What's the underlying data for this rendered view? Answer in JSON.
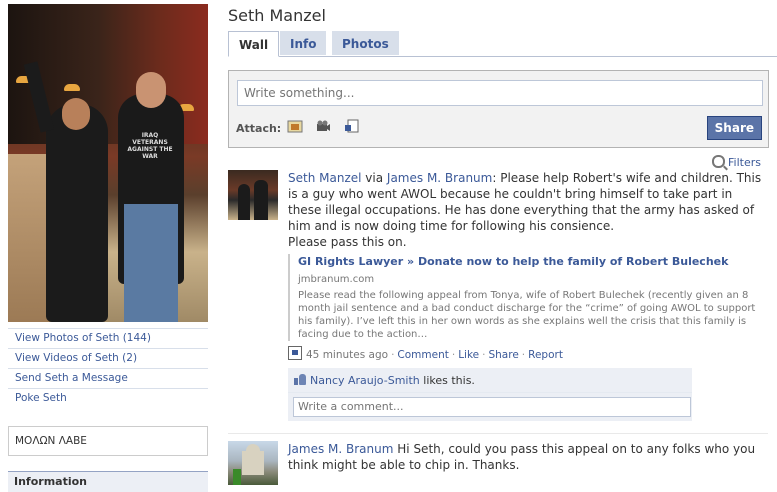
{
  "profile": {
    "name": "Seth Manzel",
    "photo_shirt_text": "IRAQ VETERANS AGAINST THE WAR"
  },
  "left_links": [
    "View Photos of Seth (144)",
    "View Videos of Seth (2)",
    "Send Seth a Message",
    "Poke Seth"
  ],
  "bio": "ΜΟΛΩΝ ΛΑΒΕ",
  "info_header": "Information",
  "tabs": [
    {
      "label": "Wall",
      "active": true
    },
    {
      "label": "Info",
      "active": false
    },
    {
      "label": "Photos",
      "active": false
    }
  ],
  "composer": {
    "placeholder": "Write something...",
    "attach_label": "Attach:",
    "attach_icons": [
      "photo-icon",
      "video-icon",
      "link-icon"
    ],
    "share_label": "Share"
  },
  "filters_label": "Filters",
  "stories": [
    {
      "author": "Seth Manzel",
      "via": "via",
      "via_author": "James M. Branum",
      "text": ": Please help Robert's wife and children. This is a guy who went AWOL because he couldn't bring himself to take part in these illegal occupations. He has done everything that the army has asked of him and is now doing time for following his consience.",
      "text2": "Please pass this on.",
      "attachment": {
        "title": "GI Rights Lawyer » Donate now to help the family of Robert Bulechek",
        "domain": "jmbranum.com",
        "description": "Please read the following appeal from Tonya, wife of Robert Bulechek (recently given an 8 month jail sentence and a bad conduct discharge for the “crime” of going AWOL to support his family). I’ve left this in her own words as she explains well the crisis that this family is facing due to the action…"
      },
      "meta": {
        "time": "45 minutes ago",
        "comment": "Comment",
        "like": "Like",
        "share": "Share",
        "report": "Report"
      },
      "likes": {
        "name": "Nancy Araujo-Smith",
        "suffix": "likes this."
      },
      "comment_placeholder": "Write a comment..."
    },
    {
      "author": "James M. Branum",
      "text": "Hi Seth, could you pass this appeal on to any folks who you think might be able to chip in. Thanks."
    }
  ]
}
